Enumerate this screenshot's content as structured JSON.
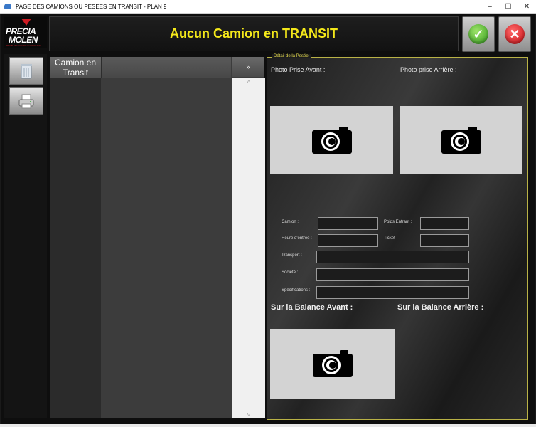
{
  "window": {
    "title": "PAGE DES CAMIONS OU PESEES EN TRANSIT - PLAN 9",
    "min": "–",
    "max": "☐",
    "close": "✕"
  },
  "logo": {
    "line1": "PRECIA",
    "line2": "MOLEN",
    "tagline": "PROBLEM SOLVING IN WEIGHING"
  },
  "header": {
    "title": "Aucun Camion en TRANSIT"
  },
  "actions": {
    "ok_icon": "check-icon",
    "cancel_icon": "cross-icon",
    "ok_glyph": "✓",
    "cancel_glyph": "✕"
  },
  "grid": {
    "column_header": "Camion en\nTransit",
    "expand_glyph": "»"
  },
  "detail": {
    "legend": "Détail de la Pesée",
    "photo_front_label": "Photo Prise Avant :",
    "photo_rear_label": "Photo prise Arrière :",
    "fields": {
      "camion": "Camion :",
      "poids_entrant": "Poids Entrant  :",
      "heure_entree": "Heure d'entrée :",
      "ticket": "Ticket :",
      "transport": "Transport :",
      "societe": "Société :",
      "specifications": "Spécifications :"
    },
    "balance_front_label": "Sur la Balance Avant :",
    "balance_rear_label": "Sur la Balance Arrière :"
  },
  "colors": {
    "accent_yellow": "#f4e81a",
    "ok_green": "#2f9a1a",
    "cancel_red": "#c80d12"
  }
}
